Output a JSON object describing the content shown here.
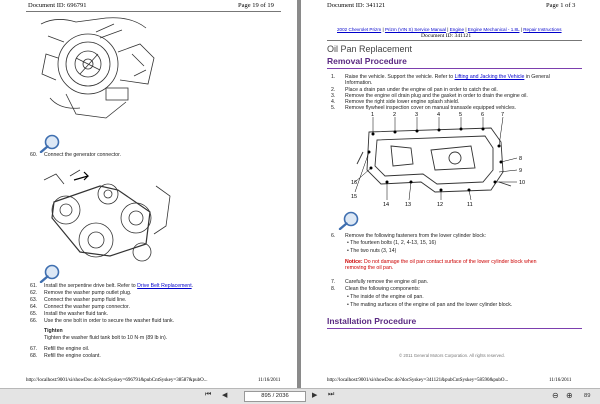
{
  "left_page": {
    "doc_id": "Document ID: 696791",
    "page_num": "Page 19 of 19",
    "step60": "60.",
    "step60_text": "Connect the generator connector.",
    "step61": "61.",
    "step61_text": "Install the serpentine drive belt. Refer to ",
    "step61_link": "Drive Belt Replacement",
    "step61_end": ".",
    "step62": "62.",
    "step62_text": "Remove the washer pump outlet plug.",
    "step63": "63.",
    "step63_text": "Connect the washer pump fluid line.",
    "step64": "64.",
    "step64_text": "Connect the washer pump connector.",
    "step65": "65.",
    "step65_text": "Install the washer fluid tank.",
    "step66": "66.",
    "step66_text": "Use the one bolt in order to secure the washer fluid tank.",
    "tighten_title": "Tighten",
    "tighten_text": "Tighten the washer fluid tank bolt to 10 N·m (89 lb in).",
    "step67": "67.",
    "step67_text": "Refill the engine oil.",
    "step68": "68.",
    "step68_text": "Refill the engine coolant.",
    "footer_url": "http://localhost:9001/si/showDoc.do?docSyskey=696791&pubCntSyskey=38587&pubO...",
    "footer_date": "11/16/2011"
  },
  "right_page": {
    "doc_id": "Document ID: 341121",
    "page_num": "Page 1 of 3",
    "breadcrumb": [
      "2002 Chevrolet Prizm",
      "Prizm (VIN S) Service Manual",
      "Engine",
      "Engine Mechanical - 1.8L",
      "Repair Instructions"
    ],
    "breadcrumb_sep": "|",
    "doc_id_center": "Document ID: 341121",
    "title": "Oil Pan Replacement",
    "removal_heading": "Removal Procedure",
    "steps": [
      {
        "n": "1.",
        "t": "Raise the vehicle. Support the vehicle. Refer to ",
        "link": "Lifting and Jacking the Vehicle",
        "t2": " in General"
      },
      {
        "n": "",
        "t": "Information.",
        "link": "",
        "t2": ""
      },
      {
        "n": "2.",
        "t": "Place a drain pan under the engine oil pan in order to catch the oil.",
        "link": "",
        "t2": ""
      },
      {
        "n": "3.",
        "t": "Remove the engine oil drain plug and the gasket in order to drain the engine oil.",
        "link": "",
        "t2": ""
      },
      {
        "n": "4.",
        "t": "Remove the right side lower engine splash shield.",
        "link": "",
        "t2": ""
      },
      {
        "n": "5.",
        "t": "Remove flywheel inspection cover on manual transaxle equipped vehicles.",
        "link": "",
        "t2": ""
      }
    ],
    "diagram_top_labels": [
      "1",
      "2",
      "3",
      "4",
      "5",
      "6",
      "7"
    ],
    "diagram_left_labels": [
      "16",
      "15"
    ],
    "diagram_right_labels": [
      "8",
      "9",
      "10"
    ],
    "diagram_bottom_labels": [
      "14",
      "13",
      "12",
      "11"
    ],
    "step6": "6.",
    "step6_text": "Remove the following fasteners from the lower cylinder block:",
    "bullet1": "The fourteen bolts (1, 2, 4-13, 15, 16)",
    "bullet2": "The two nuts (3, 14)",
    "notice_label": "Notice:",
    "notice_text": " Do not damage the oil pan contact surface of the lower cylinder block when",
    "notice_text2": "removing the oil pan.",
    "step7": "7.",
    "step7_text": "Carefully remove the engine oil pan.",
    "step8": "8.",
    "step8_text": "Clean the following components:",
    "bullet3": "The inside of the engine oil pan.",
    "bullet4": "The mating surfaces of the engine oil pan and the lower cylinder block.",
    "install_heading": "Installation Procedure",
    "copyright": "© 2011 General Motors Corporation.  All rights reserved.",
    "footer_url": "http://localhost:9001/si/showDoc.do?docSyskey=341121&pubCntSyskey=58590&pubO...",
    "footer_date": "11/16/2011"
  },
  "toolbar": {
    "page_indicator": "895 / 2036",
    "zoom_partial": "89"
  },
  "colors": {
    "heading_purple": "#5a2a82",
    "link_blue": "#0000cc",
    "notice_red": "#cc0000",
    "background_gray": "#8a8a8a"
  }
}
